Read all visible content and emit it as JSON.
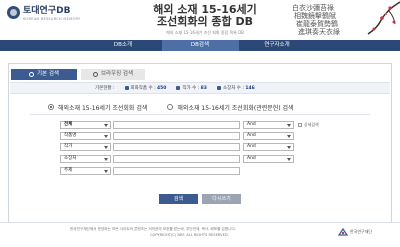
{
  "header": {
    "logo_title": "토대연구DB",
    "logo_subtitle": "KOREAN RESEARCH MEMORY",
    "title_line1": "해외 소재 15-16세기",
    "title_line2": "조선회화의 종합 DB",
    "title_caption": "해외 소재 15-16세기 조선 회화 종합 목록 DB",
    "calligraphy_cols": [
      "白衣沙彌苔祿",
      "相魏鏡擊鶴賦",
      "崔龍泰賀勢鶴",
      "進琪奏天衣綠"
    ]
  },
  "nav": {
    "items": [
      "DB소개",
      "DB검색",
      "연구자소개"
    ],
    "active_index": 1
  },
  "search": {
    "tabs": [
      "기본 검색",
      "브라우징 검색"
    ],
    "basis_label": "기본현황 :",
    "basis": [
      {
        "label": "회화작품 수 :",
        "count": "450"
      },
      {
        "label": "작가 수 :",
        "count": "83"
      },
      {
        "label": "소장처 수 :",
        "count": "146"
      }
    ],
    "scope_options": [
      {
        "label": "해외소재 15-16세기 조선회화 검색",
        "selected": true
      },
      {
        "label": "해외소재 15-16세기 조선회화(관련문헌) 검색",
        "selected": false
      }
    ],
    "fields": [
      {
        "field": "전체",
        "operator": "And"
      },
      {
        "field": "작품명",
        "operator": "And"
      },
      {
        "field": "작가",
        "operator": "And"
      },
      {
        "field": "소장처",
        "operator": "And"
      },
      {
        "field": "주제",
        "operator": ""
      }
    ],
    "detail_label": "상세검색",
    "search_button": "검색",
    "reset_button": "다시쓰기"
  },
  "footer": {
    "line1": "한국연구재단에서 운영하는 모든 사이트의 콘텐츠는 저작권의 보호를 받는바, 무단전재, 복사, 배포를 금합니다.",
    "line2": "COPYRIGHT(C) NRF. ALL RIGHTS RESERVED.",
    "org_name": "한국연구재단"
  },
  "colors": {
    "nav_bg": "#2c4876",
    "nav_active": "#4d6fa6",
    "tab_active": "#3c5c91",
    "count_text": "#1b3f8a"
  }
}
